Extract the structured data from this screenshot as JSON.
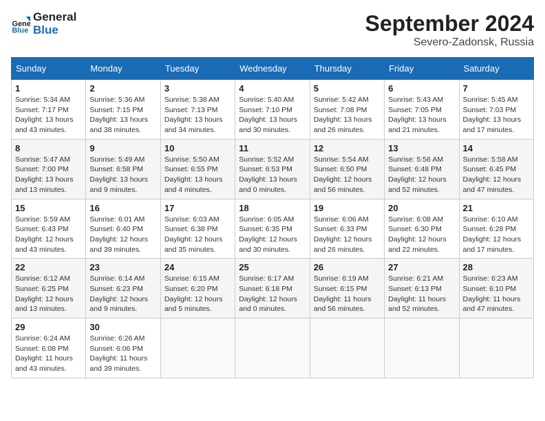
{
  "header": {
    "logo_line1": "General",
    "logo_line2": "Blue",
    "month": "September 2024",
    "location": "Severo-Zadonsk, Russia"
  },
  "weekdays": [
    "Sunday",
    "Monday",
    "Tuesday",
    "Wednesday",
    "Thursday",
    "Friday",
    "Saturday"
  ],
  "weeks": [
    [
      {
        "day": "1",
        "sunrise": "Sunrise: 5:34 AM",
        "sunset": "Sunset: 7:17 PM",
        "daylight": "Daylight: 13 hours and 43 minutes."
      },
      {
        "day": "2",
        "sunrise": "Sunrise: 5:36 AM",
        "sunset": "Sunset: 7:15 PM",
        "daylight": "Daylight: 13 hours and 38 minutes."
      },
      {
        "day": "3",
        "sunrise": "Sunrise: 5:38 AM",
        "sunset": "Sunset: 7:13 PM",
        "daylight": "Daylight: 13 hours and 34 minutes."
      },
      {
        "day": "4",
        "sunrise": "Sunrise: 5:40 AM",
        "sunset": "Sunset: 7:10 PM",
        "daylight": "Daylight: 13 hours and 30 minutes."
      },
      {
        "day": "5",
        "sunrise": "Sunrise: 5:42 AM",
        "sunset": "Sunset: 7:08 PM",
        "daylight": "Daylight: 13 hours and 26 minutes."
      },
      {
        "day": "6",
        "sunrise": "Sunrise: 5:43 AM",
        "sunset": "Sunset: 7:05 PM",
        "daylight": "Daylight: 13 hours and 21 minutes."
      },
      {
        "day": "7",
        "sunrise": "Sunrise: 5:45 AM",
        "sunset": "Sunset: 7:03 PM",
        "daylight": "Daylight: 13 hours and 17 minutes."
      }
    ],
    [
      {
        "day": "8",
        "sunrise": "Sunrise: 5:47 AM",
        "sunset": "Sunset: 7:00 PM",
        "daylight": "Daylight: 13 hours and 13 minutes."
      },
      {
        "day": "9",
        "sunrise": "Sunrise: 5:49 AM",
        "sunset": "Sunset: 6:58 PM",
        "daylight": "Daylight: 13 hours and 9 minutes."
      },
      {
        "day": "10",
        "sunrise": "Sunrise: 5:50 AM",
        "sunset": "Sunset: 6:55 PM",
        "daylight": "Daylight: 13 hours and 4 minutes."
      },
      {
        "day": "11",
        "sunrise": "Sunrise: 5:52 AM",
        "sunset": "Sunset: 6:53 PM",
        "daylight": "Daylight: 13 hours and 0 minutes."
      },
      {
        "day": "12",
        "sunrise": "Sunrise: 5:54 AM",
        "sunset": "Sunset: 6:50 PM",
        "daylight": "Daylight: 12 hours and 56 minutes."
      },
      {
        "day": "13",
        "sunrise": "Sunrise: 5:56 AM",
        "sunset": "Sunset: 6:48 PM",
        "daylight": "Daylight: 12 hours and 52 minutes."
      },
      {
        "day": "14",
        "sunrise": "Sunrise: 5:58 AM",
        "sunset": "Sunset: 6:45 PM",
        "daylight": "Daylight: 12 hours and 47 minutes."
      }
    ],
    [
      {
        "day": "15",
        "sunrise": "Sunrise: 5:59 AM",
        "sunset": "Sunset: 6:43 PM",
        "daylight": "Daylight: 12 hours and 43 minutes."
      },
      {
        "day": "16",
        "sunrise": "Sunrise: 6:01 AM",
        "sunset": "Sunset: 6:40 PM",
        "daylight": "Daylight: 12 hours and 39 minutes."
      },
      {
        "day": "17",
        "sunrise": "Sunrise: 6:03 AM",
        "sunset": "Sunset: 6:38 PM",
        "daylight": "Daylight: 12 hours and 35 minutes."
      },
      {
        "day": "18",
        "sunrise": "Sunrise: 6:05 AM",
        "sunset": "Sunset: 6:35 PM",
        "daylight": "Daylight: 12 hours and 30 minutes."
      },
      {
        "day": "19",
        "sunrise": "Sunrise: 6:06 AM",
        "sunset": "Sunset: 6:33 PM",
        "daylight": "Daylight: 12 hours and 26 minutes."
      },
      {
        "day": "20",
        "sunrise": "Sunrise: 6:08 AM",
        "sunset": "Sunset: 6:30 PM",
        "daylight": "Daylight: 12 hours and 22 minutes."
      },
      {
        "day": "21",
        "sunrise": "Sunrise: 6:10 AM",
        "sunset": "Sunset: 6:28 PM",
        "daylight": "Daylight: 12 hours and 17 minutes."
      }
    ],
    [
      {
        "day": "22",
        "sunrise": "Sunrise: 6:12 AM",
        "sunset": "Sunset: 6:25 PM",
        "daylight": "Daylight: 12 hours and 13 minutes."
      },
      {
        "day": "23",
        "sunrise": "Sunrise: 6:14 AM",
        "sunset": "Sunset: 6:23 PM",
        "daylight": "Daylight: 12 hours and 9 minutes."
      },
      {
        "day": "24",
        "sunrise": "Sunrise: 6:15 AM",
        "sunset": "Sunset: 6:20 PM",
        "daylight": "Daylight: 12 hours and 5 minutes."
      },
      {
        "day": "25",
        "sunrise": "Sunrise: 6:17 AM",
        "sunset": "Sunset: 6:18 PM",
        "daylight": "Daylight: 12 hours and 0 minutes."
      },
      {
        "day": "26",
        "sunrise": "Sunrise: 6:19 AM",
        "sunset": "Sunset: 6:15 PM",
        "daylight": "Daylight: 11 hours and 56 minutes."
      },
      {
        "day": "27",
        "sunrise": "Sunrise: 6:21 AM",
        "sunset": "Sunset: 6:13 PM",
        "daylight": "Daylight: 11 hours and 52 minutes."
      },
      {
        "day": "28",
        "sunrise": "Sunrise: 6:23 AM",
        "sunset": "Sunset: 6:10 PM",
        "daylight": "Daylight: 11 hours and 47 minutes."
      }
    ],
    [
      {
        "day": "29",
        "sunrise": "Sunrise: 6:24 AM",
        "sunset": "Sunset: 6:08 PM",
        "daylight": "Daylight: 11 hours and 43 minutes."
      },
      {
        "day": "30",
        "sunrise": "Sunrise: 6:26 AM",
        "sunset": "Sunset: 6:06 PM",
        "daylight": "Daylight: 11 hours and 39 minutes."
      },
      null,
      null,
      null,
      null,
      null
    ]
  ]
}
